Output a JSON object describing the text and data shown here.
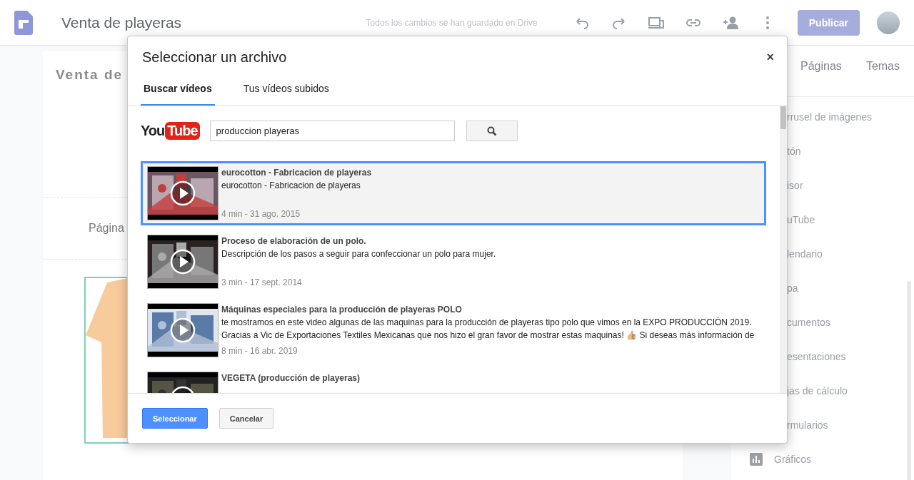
{
  "app_bar": {
    "title": "Venta de playeras",
    "save_status": "Todos los cambios se han guardado en Drive",
    "publish_button": "Publicar"
  },
  "canvas": {
    "site_title": "Venta de",
    "page_label": "Página"
  },
  "side_panel": {
    "tabs": [
      {
        "label": "Páginas",
        "selected": false
      },
      {
        "label": "Temas",
        "selected": false
      }
    ],
    "items": [
      {
        "label": "rrusel de imágenes",
        "kind": "covered"
      },
      {
        "label": "tón",
        "kind": "covered"
      },
      {
        "label": "isor",
        "kind": "covered"
      },
      {
        "label": "uTube",
        "kind": "covered"
      },
      {
        "label": "lendario",
        "kind": "covered"
      },
      {
        "label": "pa",
        "kind": "covered"
      },
      {
        "label": "cumentos",
        "kind": "covered"
      },
      {
        "label": "esentaciones",
        "kind": "covered"
      },
      {
        "label": "jas de cálculo",
        "kind": "covered"
      },
      {
        "label": "rmularios",
        "kind": "covered"
      },
      {
        "label": "Gráficos",
        "kind": "full"
      }
    ]
  },
  "dialog": {
    "title": "Seleccionar un archivo",
    "close": "×",
    "tabs": [
      {
        "label": "Buscar vídeos",
        "selected": true
      },
      {
        "label": "Tus vídeos subidos",
        "selected": false
      }
    ],
    "logo": {
      "you": "You",
      "tube": "Tube"
    },
    "search": {
      "value": "produccion playeras"
    },
    "results": [
      {
        "title": "eurocotton - Fabricacion de playeras",
        "description": [
          "eurocotton - Fabricacion de playeras"
        ],
        "meta": "4 min - 31 ago. 2015",
        "selected": true
      },
      {
        "title": "Proceso de elaboración de un polo.",
        "description": [
          "Descripción de los pasos a seguir para confeccionar un polo para mujer."
        ],
        "meta": "3 min - 17 sept. 2014",
        "selected": false
      },
      {
        "title": "Máquinas especiales para la producción de playeras POLO",
        "description": [
          "te mostramos en este video algunas de las maquinas para la producción de playeras tipo polo que vimos en la EXPO PRODUCCIÓN 2019.",
          "Gracias a Vic de Exportaciones Textiles Mexicanas que nos hizo el gran favor de mostrar estas maquinas! 👍🏼 Si deseas más información de"
        ],
        "meta": "8 min - 16 abr. 2019",
        "selected": false
      },
      {
        "title": "VEGETA (producción de playeras)",
        "selected": false
      }
    ],
    "buttons": [
      {
        "label": "Seleccionar",
        "kind": "primary"
      },
      {
        "label": "Cancelar",
        "kind": "secondary"
      }
    ]
  }
}
